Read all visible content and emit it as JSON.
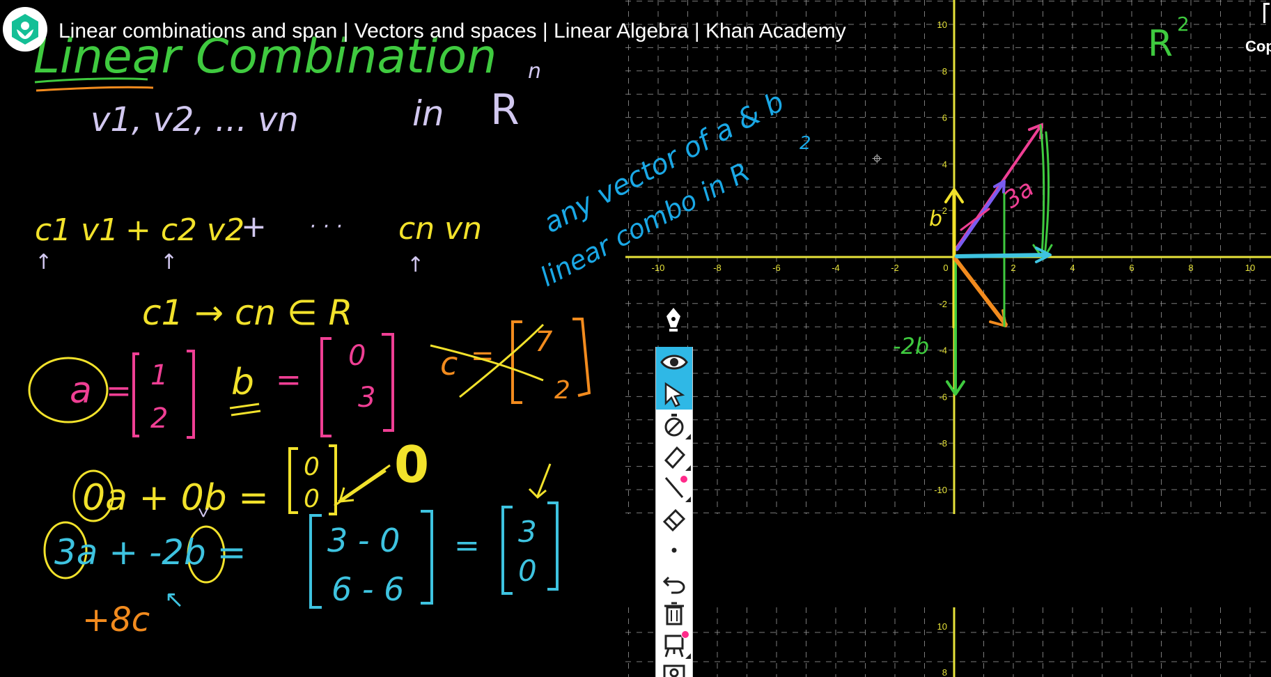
{
  "video": {
    "title": "Linear combinations and span | Vectors and spaces | Linear Algebra | Khan Academy",
    "channel_logo": "khan-academy-logo",
    "top_right_label": "Copy"
  },
  "board": {
    "heading": "Linear Combination",
    "line_vectors": "v1, v2, ... vn",
    "line_in": "in",
    "R_symbol": "R",
    "superscript_n": "n",
    "superscript_2": "2",
    "combo_terms": [
      "c1 v1",
      "+ c2 v2",
      "+",
      "· · ·",
      "cn vn"
    ],
    "scalar_range": "c1 → cn ∈ R",
    "vec_a": "a",
    "vec_b": "b",
    "vec_c": "c",
    "eq_sign": "=",
    "a_components": [
      "1",
      "2"
    ],
    "b_components": [
      "0",
      "3"
    ],
    "c_components": [
      "7",
      "2"
    ],
    "zero_combo": "0a + 0b =",
    "zero_vector": [
      "0",
      "0"
    ],
    "zero_big": "0",
    "three_combo": "3a + -2b =",
    "diff_matrix": [
      "3 - 0",
      "6 - 6"
    ],
    "result_vector": [
      "3",
      "0"
    ],
    "plus_8c": "+8c",
    "note_line1": "any vector of a & b",
    "note_line2": "linear combo in R",
    "graph_R2": "R",
    "graph_vec_labels": [
      "b",
      "a",
      "3a",
      "-2b"
    ]
  },
  "graph": {
    "x_ticks": [
      "-10",
      "-8",
      "-6",
      "-4",
      "-2",
      "0",
      "2",
      "4",
      "6",
      "8",
      "10"
    ],
    "y_ticks": [
      "10",
      "8",
      "6",
      "4",
      "2",
      "0",
      "-2",
      "-4",
      "-6",
      "-8",
      "-10"
    ],
    "x_vals": [
      -10,
      -8,
      -6,
      -4,
      -2,
      0,
      2,
      4,
      6,
      8,
      10
    ],
    "y_vals": [
      10,
      8,
      6,
      4,
      2,
      0,
      -2,
      -4,
      -6,
      -8,
      -10
    ],
    "second_y_ticks": [
      "10",
      "8"
    ],
    "axis_color": "#e7e33a",
    "grid_color": "#9a9a9a"
  },
  "toolbar": {
    "tools": [
      {
        "name": "pen-icon",
        "active": false
      },
      {
        "name": "eye-icon",
        "active": true
      },
      {
        "name": "cursor-arrow-icon",
        "active": true
      },
      {
        "name": "stopwatch-icon",
        "active": false
      },
      {
        "name": "highlighter-icon",
        "active": false
      },
      {
        "name": "line-tool-icon",
        "active": false
      },
      {
        "name": "eraser-icon",
        "active": false
      },
      {
        "name": "dot-size-icon",
        "active": false
      },
      {
        "name": "undo-icon",
        "active": false
      },
      {
        "name": "trash-icon",
        "active": false
      },
      {
        "name": "easel-icon",
        "active": false
      },
      {
        "name": "camera-icon",
        "active": false
      }
    ]
  },
  "colors": {
    "green": "#3fca3f",
    "lavender": "#d2c8f0",
    "yellow": "#f2e22b",
    "pink": "#ef3f94",
    "orange": "#f28b1e",
    "cyan": "#3ec3e0",
    "blue": "#1aa8e6",
    "purple": "#7a5cf0"
  }
}
